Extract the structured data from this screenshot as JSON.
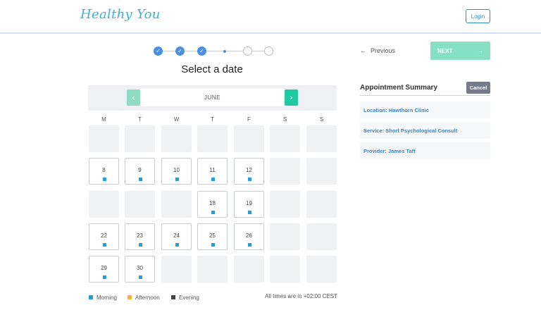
{
  "header": {
    "logo_text": "Healthy You",
    "login_label": "Login"
  },
  "stepper": {
    "check_glyph": "✓"
  },
  "page_title": "Select a date",
  "calendar": {
    "month": "JUNE",
    "prev_icon": "‹",
    "next_icon": "›",
    "weekdays": [
      "M",
      "T",
      "W",
      "T",
      "F",
      "S",
      "S"
    ],
    "available_days": [
      "8",
      "9",
      "10",
      "11",
      "12",
      "18",
      "19",
      "22",
      "23",
      "24",
      "25",
      "26",
      "29",
      "30"
    ]
  },
  "legend": {
    "morning": "Morning",
    "afternoon": "Afternoon",
    "evening": "Evening"
  },
  "colors": {
    "morning": "#2a9fd6",
    "afternoon": "#f5b041",
    "evening": "#444444",
    "accent": "#1fc9a2"
  },
  "timezone_note": "All times are in +02:00 CEST",
  "nav": {
    "previous_label": "Previous",
    "previous_icon": "←",
    "next_label": "NEXT",
    "next_icon": "→"
  },
  "summary": {
    "title": "Appointment Summary",
    "cancel_label": "Cancel",
    "location": "Location: Hawthorn Clinic",
    "service": "Service: Short Psychological Consult",
    "provider": "Provider: James Taff"
  }
}
